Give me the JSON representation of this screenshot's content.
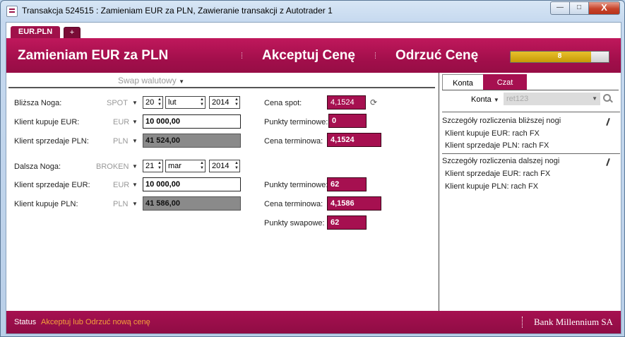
{
  "window": {
    "title": "Transakcja 524515 : Zamieniam EUR za PLN, Zawieranie transakcji z Autotrader 1",
    "controls": {
      "minimize": "—",
      "maximize": "□",
      "close": "X"
    }
  },
  "tabs": {
    "active": "EUR.PLN",
    "add": "+"
  },
  "banner": {
    "title": "Zamieniam EUR za PLN",
    "accept": "Akceptuj Cenę",
    "reject": "Odrzuć Cenę",
    "timer_value": "8",
    "timer_fraction": 0.82
  },
  "form": {
    "swap": "Swap walutowy",
    "near": {
      "label": "Bliższa Noga:",
      "type": "SPOT",
      "day": "20",
      "month": "lut",
      "year": "2014",
      "buy_label": "Klient kupuje EUR:",
      "buy_currency": "EUR",
      "buy_amount": "10 000,00",
      "sell_label": "Klient sprzedaje PLN:",
      "sell_currency": "PLN",
      "sell_amount": "41 524,00"
    },
    "far": {
      "label": "Dalsza Noga:",
      "type": "BROKEN",
      "day": "21",
      "month": "mar",
      "year": "2014",
      "sell_label": "Klient sprzedaje EUR:",
      "sell_currency": "EUR",
      "sell_amount": "10 000,00",
      "buy_label": "Klient kupuje PLN:",
      "buy_currency": "PLN",
      "buy_amount": "41 586,00"
    },
    "prices": {
      "spot_label": "Cena spot:",
      "spot": "4,1524",
      "near_points_label": "Punkty terminowe:",
      "near_points": "0",
      "near_rate_label": "Cena terminowa:",
      "near_rate": "4,1524",
      "far_points_label": "Punkty terminowe:",
      "far_points": "62",
      "far_rate_label": "Cena terminowa:",
      "far_rate": "4,1586",
      "swap_points_label": "Punkty swapowe:",
      "swap_points": "62"
    }
  },
  "side": {
    "tabs": [
      "Konta",
      "Czat"
    ],
    "account_label": "Konta",
    "account_value": "ret123",
    "near_title": "Szczegóły rozliczenia bliższej nogi",
    "near_items": [
      "Klient kupuje EUR: rach FX",
      "Klient sprzedaje PLN: rach FX"
    ],
    "far_title": "Szczegóły rozliczenia dalszej nogi",
    "far_items": [
      "Klient sprzedaje EUR: rach FX",
      "Klient kupuje PLN: rach FX"
    ]
  },
  "status": {
    "label": "Status",
    "text": "Akceptuj lub Odrzuć nową cenę",
    "bank": "Bank Millennium SA"
  }
}
